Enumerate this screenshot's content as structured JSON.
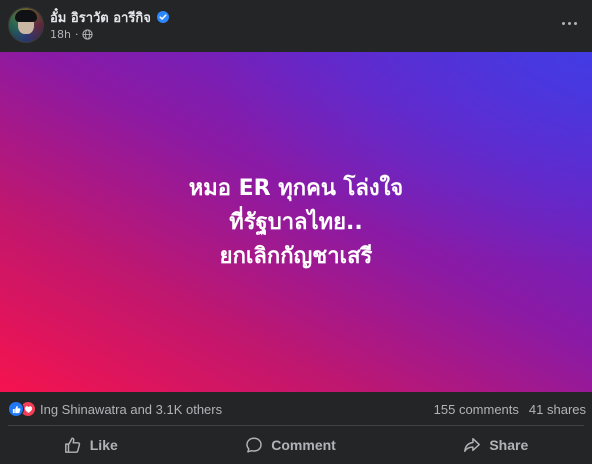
{
  "post": {
    "author": {
      "name": "อั๋ม อิราวัต อารีกิจ",
      "verified": true,
      "avatar_icon": "avatar"
    },
    "time": "18h",
    "privacy_icon": "globe-icon",
    "more_icon": "more-options-icon",
    "body_lines": [
      "หมอ ER ทุกคน โล่งใจ",
      "ที่รัฐบาลไทย..",
      "ยกเลิกกัญชาเสรี"
    ],
    "background_colors": [
      "#f5134e",
      "#c0176f",
      "#8a1aa5",
      "#4a2fd6"
    ]
  },
  "stats": {
    "reaction_icons": [
      "like-reaction-icon",
      "love-reaction-icon"
    ],
    "reactions_text": "Ing Shinawatra and 3.1K others",
    "comments": "155 comments",
    "shares": "41 shares"
  },
  "actions": {
    "like": "Like",
    "comment": "Comment",
    "share": "Share"
  },
  "colors": {
    "background": "#242526",
    "text_primary": "#e4e6eb",
    "text_secondary": "#b0b3b8",
    "like_blue": "#2078f4",
    "love_red": "#f33e58",
    "verified_blue": "#2d88ff"
  }
}
